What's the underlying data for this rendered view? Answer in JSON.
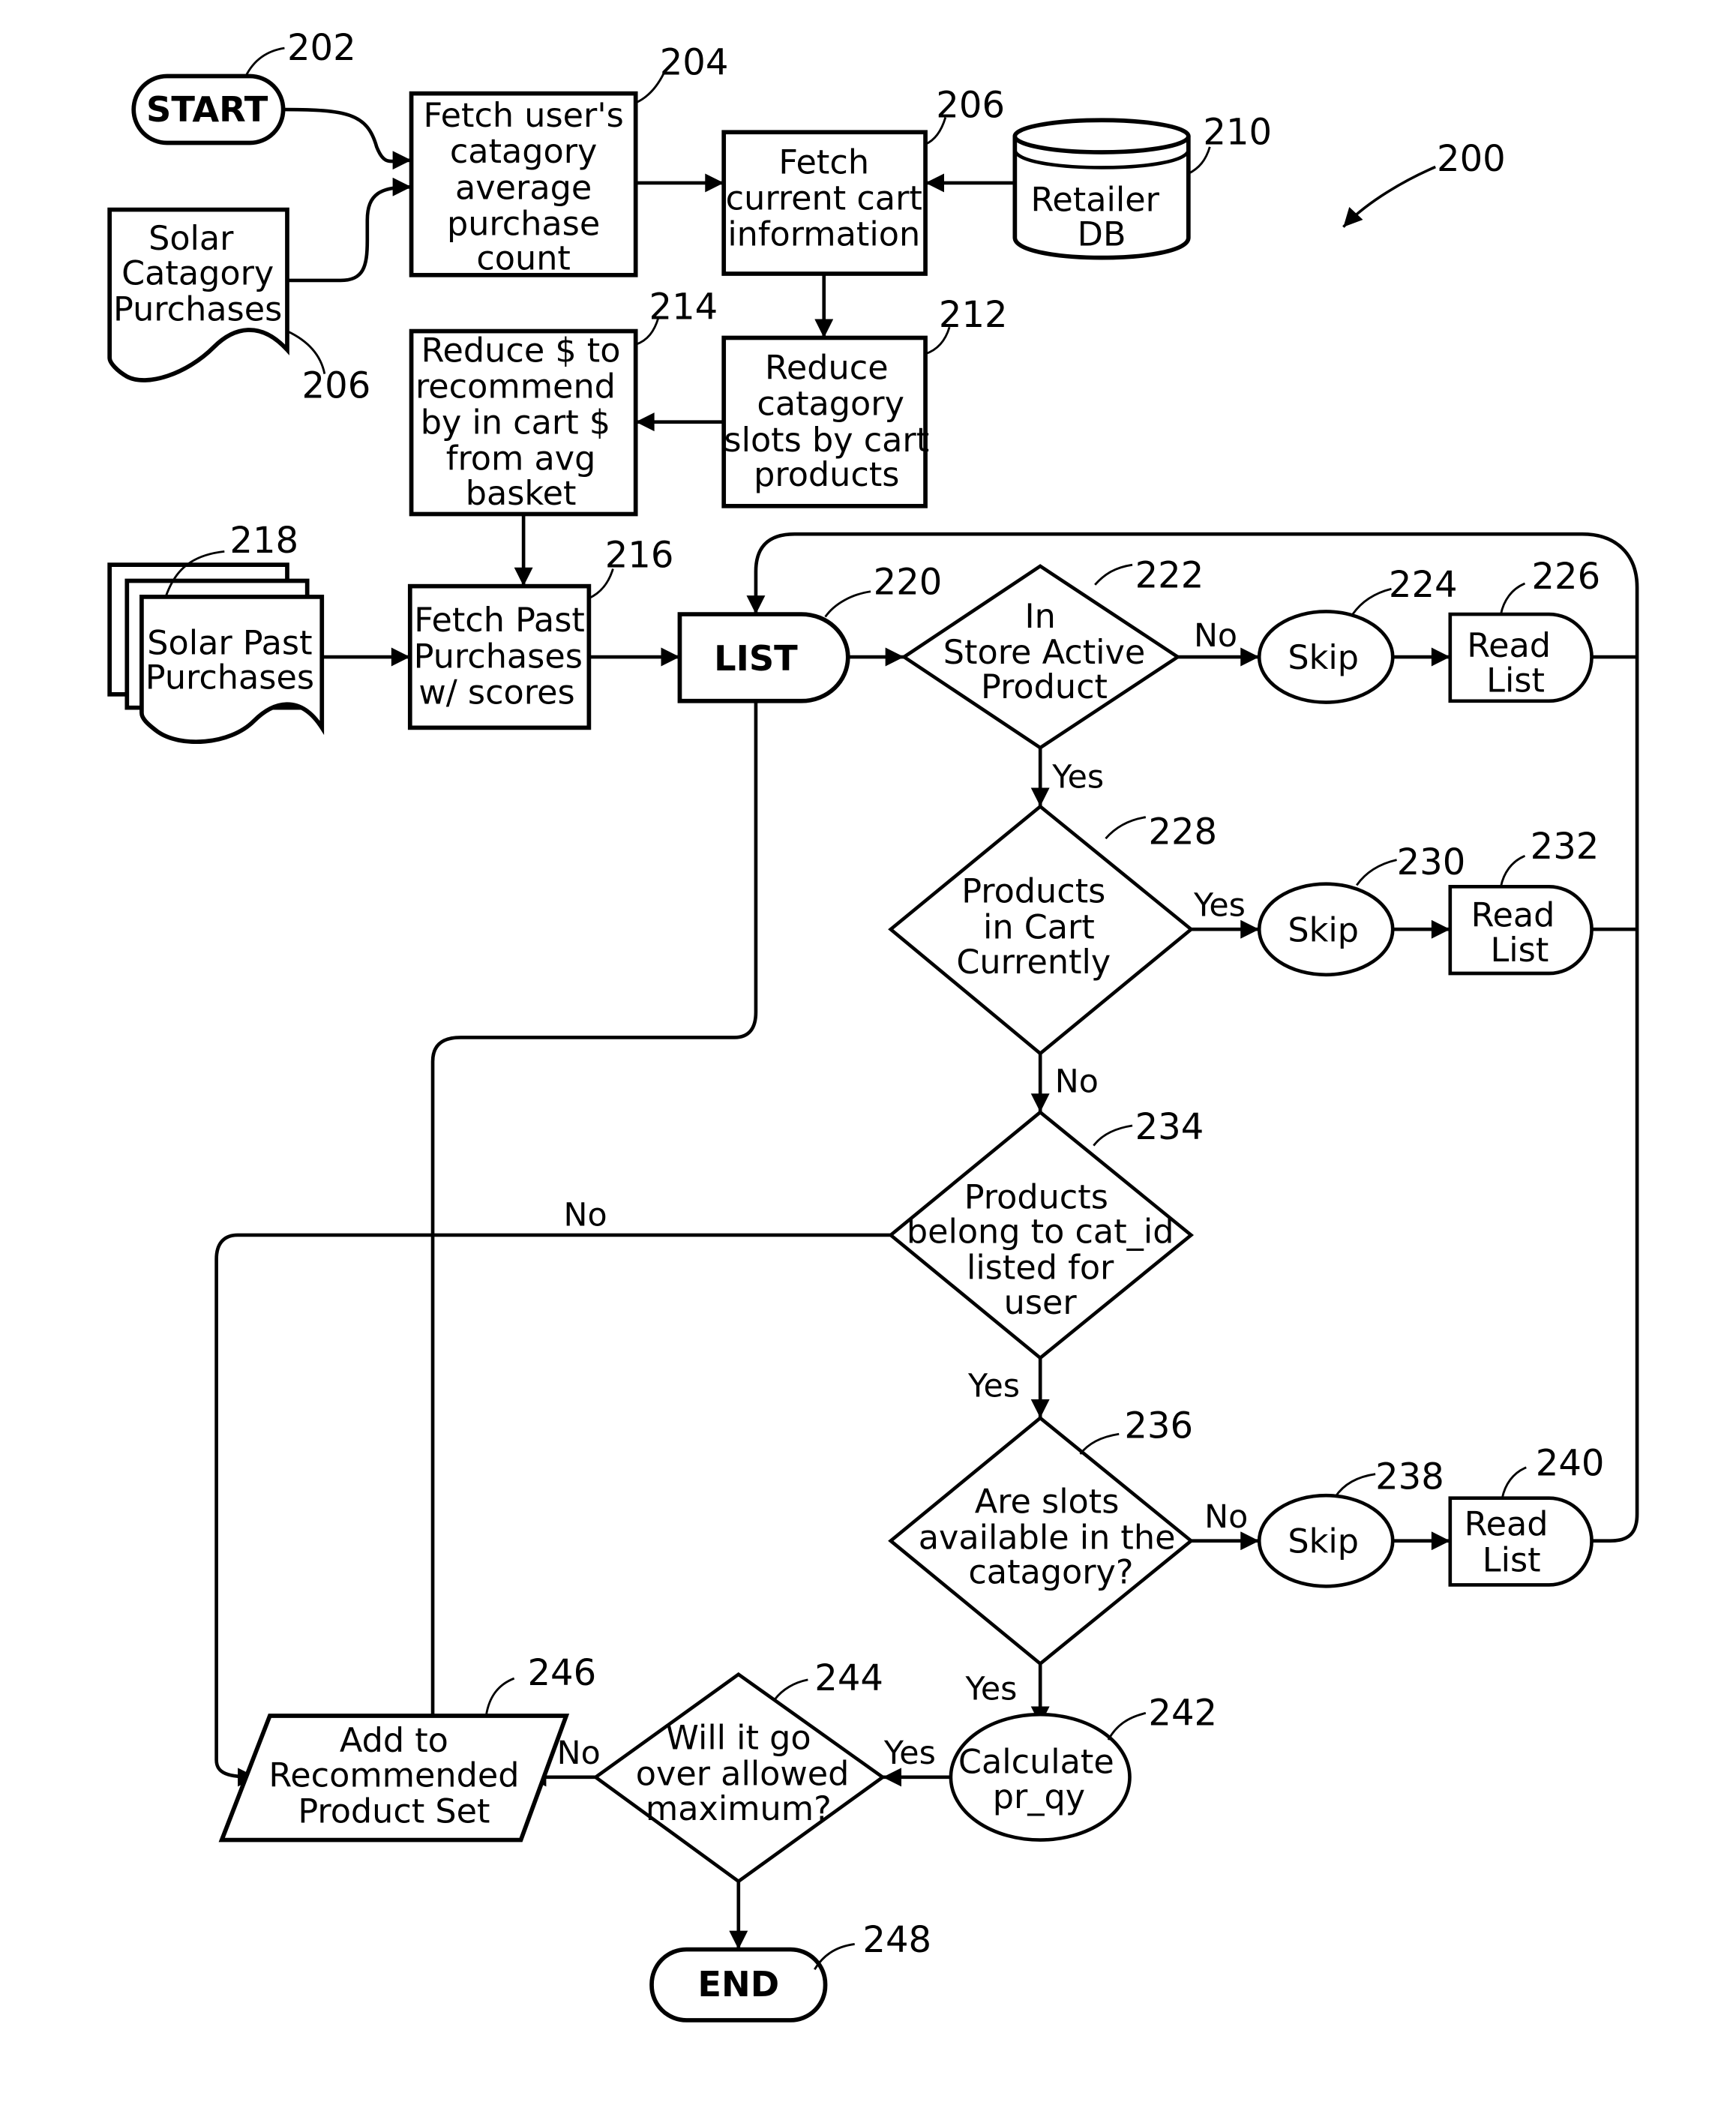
{
  "figure_ref": "200",
  "nodes": {
    "start": {
      "ref": "202",
      "lines": [
        "START"
      ]
    },
    "fetch_avg": {
      "ref": "204",
      "lines": [
        "Fetch user's",
        "catagory",
        "average",
        "purchase",
        "count"
      ]
    },
    "solar_cat": {
      "ref": "206",
      "lines": [
        "Solar",
        "Catagory",
        "Purchases"
      ]
    },
    "fetch_cart": {
      "ref": "206",
      "lines": [
        "Fetch",
        "current cart",
        "information"
      ]
    },
    "retailer_db": {
      "ref": "210",
      "lines": [
        "Retailer",
        "DB"
      ]
    },
    "reduce_slots": {
      "ref": "212",
      "lines": [
        "Reduce",
        "catagory",
        "slots by cart",
        "products"
      ]
    },
    "reduce_dollars": {
      "ref": "214",
      "lines": [
        "Reduce $ to",
        "recommend",
        "by in cart $",
        "from avg",
        "basket"
      ]
    },
    "solar_past": {
      "ref": "218",
      "lines": [
        "Solar Past",
        "Purchases"
      ]
    },
    "fetch_past": {
      "ref": "216",
      "lines": [
        "Fetch Past",
        "Purchases",
        "w/ scores"
      ]
    },
    "list": {
      "ref": "220",
      "lines": [
        "LIST"
      ]
    },
    "d_active": {
      "ref": "222",
      "lines": [
        "In",
        "Store Active",
        "Product"
      ]
    },
    "skip1": {
      "ref": "224",
      "lines": [
        "Skip"
      ]
    },
    "read1": {
      "ref": "226",
      "lines": [
        "Read",
        "List"
      ]
    },
    "d_incart": {
      "ref": "228",
      "lines": [
        "Products",
        "in Cart",
        "Currently"
      ]
    },
    "skip2": {
      "ref": "230",
      "lines": [
        "Skip"
      ]
    },
    "read2": {
      "ref": "232",
      "lines": [
        "Read",
        "List"
      ]
    },
    "d_catid": {
      "ref": "234",
      "lines": [
        "Products",
        "belong to cat_id",
        "listed for",
        "user"
      ]
    },
    "d_slots": {
      "ref": "236",
      "lines": [
        "Are slots",
        "available in the",
        "catagory?"
      ]
    },
    "skip3": {
      "ref": "238",
      "lines": [
        "Skip"
      ]
    },
    "read3": {
      "ref": "240",
      "lines": [
        "Read",
        "List"
      ]
    },
    "calc": {
      "ref": "242",
      "lines": [
        "Calculate",
        "pr_qy"
      ]
    },
    "d_max": {
      "ref": "244",
      "lines": [
        "Will it go",
        "over allowed",
        "maximum?"
      ]
    },
    "add_set": {
      "ref": "246",
      "lines": [
        "Add to",
        "Recommended",
        "Product Set"
      ]
    },
    "end": {
      "ref": "248",
      "lines": [
        "END"
      ]
    }
  },
  "edge_labels": {
    "active_no": "No",
    "active_yes": "Yes",
    "incart_yes": "Yes",
    "incart_no": "No",
    "catid_no": "No",
    "catid_yes": "Yes",
    "slots_no": "No",
    "slots_yes": "Yes",
    "calc_yes": "Yes",
    "max_no": "No"
  }
}
